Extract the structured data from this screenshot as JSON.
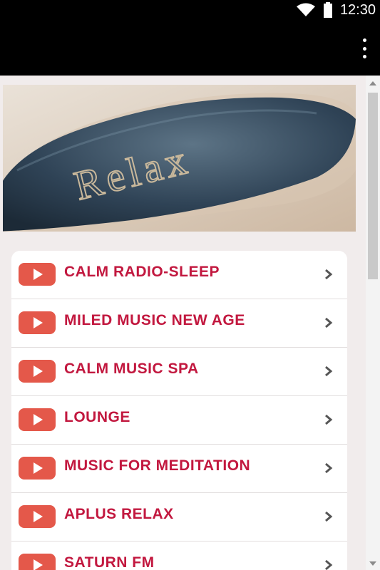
{
  "status_bar": {
    "time": "12:30"
  },
  "hero": {
    "text": "Relax"
  },
  "stations": [
    {
      "label": "CALM RADIO-SLEEP"
    },
    {
      "label": "MILED MUSIC NEW AGE"
    },
    {
      "label": "CALM MUSIC SPA"
    },
    {
      "label": "LOUNGE"
    },
    {
      "label": "MUSIC FOR MEDITATION"
    },
    {
      "label": "APLUS RELAX"
    },
    {
      "label": "SATURN FM"
    }
  ],
  "colors": {
    "accent": "#e4584a",
    "label": "#c2183f",
    "background": "#f1ecec"
  }
}
